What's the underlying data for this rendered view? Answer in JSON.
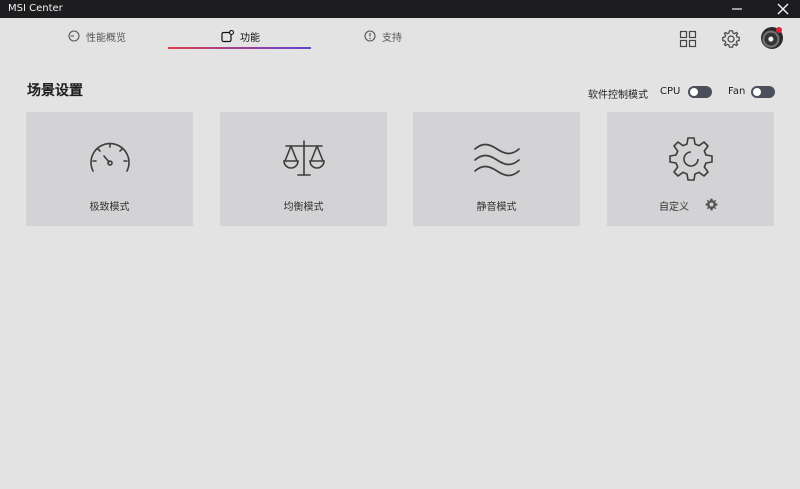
{
  "window": {
    "title": "MSI Center"
  },
  "tabs": [
    {
      "label": "性能概览",
      "icon": "dashboard-icon",
      "active": false
    },
    {
      "label": "功能",
      "icon": "feature-icon",
      "active": true
    },
    {
      "label": "支持",
      "icon": "support-icon",
      "active": false
    }
  ],
  "section": {
    "title": "场景设置",
    "mode_label": "软件控制模式",
    "toggles": [
      {
        "label": "CPU",
        "on": false
      },
      {
        "label": "Fan",
        "on": false
      }
    ]
  },
  "cards": [
    {
      "label": "极致模式",
      "icon": "speedometer-icon"
    },
    {
      "label": "均衡模式",
      "icon": "balance-scale-icon"
    },
    {
      "label": "静音模式",
      "icon": "wave-icon"
    },
    {
      "label": "自定义",
      "icon": "gear-icon"
    }
  ],
  "colors": {
    "tab_underline_start": "#e23b52",
    "tab_underline_end": "#5a45d6",
    "notification": "#e2233b"
  }
}
